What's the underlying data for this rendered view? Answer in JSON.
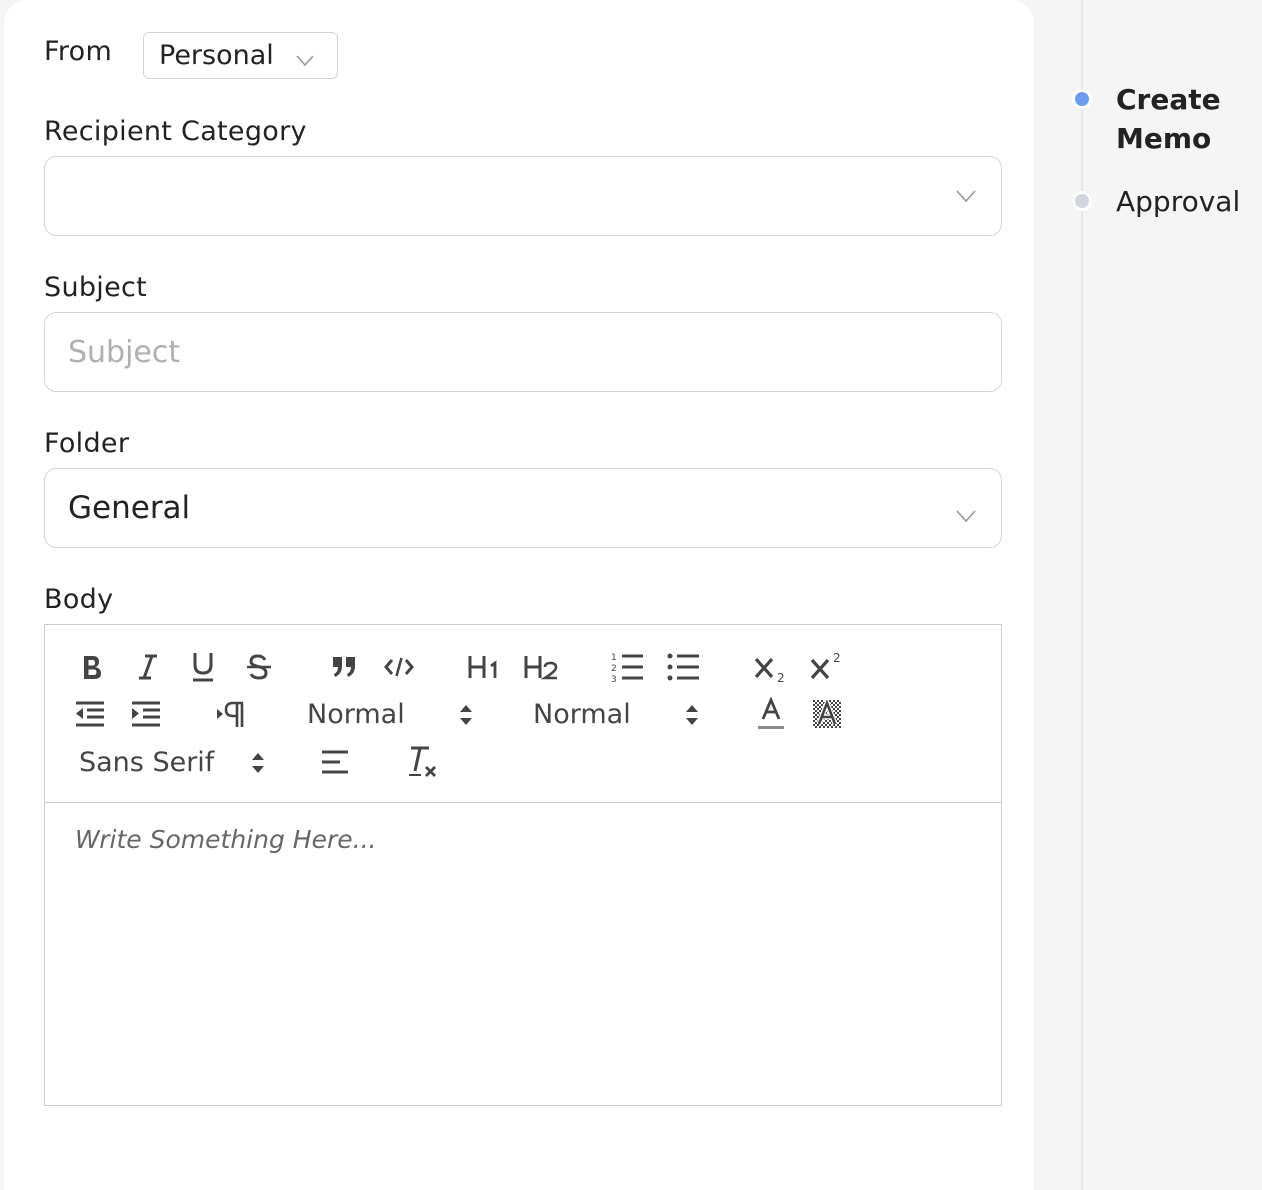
{
  "from": {
    "label": "From",
    "value": "Personal"
  },
  "recipient_category": {
    "label": "Recipient Category",
    "value": ""
  },
  "subject": {
    "label": "Subject",
    "placeholder": "Subject",
    "value": ""
  },
  "folder": {
    "label": "Folder",
    "value": "General"
  },
  "body": {
    "label": "Body",
    "placeholder": "Write Something Here...",
    "toolbar": {
      "header_size": "Normal",
      "text_size": "Normal",
      "font": "Sans Serif",
      "icons": [
        "bold-icon",
        "italic-icon",
        "underline-icon",
        "strike-icon",
        "quote-icon",
        "code-icon",
        "h1-icon",
        "h2-icon",
        "ordered-list-icon",
        "bullet-list-icon",
        "subscript-icon",
        "superscript-icon",
        "outdent-icon",
        "indent-icon",
        "rtl-icon",
        "text-color-icon",
        "background-color-icon",
        "align-icon",
        "clear-format-icon"
      ]
    }
  },
  "stepper": {
    "steps": [
      {
        "label_line1": "Create",
        "label_line2": "Memo",
        "state": "active"
      },
      {
        "label_line1": "Approval",
        "label_line2": "",
        "state": "pending"
      }
    ],
    "active_color": "#6c9bef",
    "pending_color": "#d3d6dc"
  }
}
